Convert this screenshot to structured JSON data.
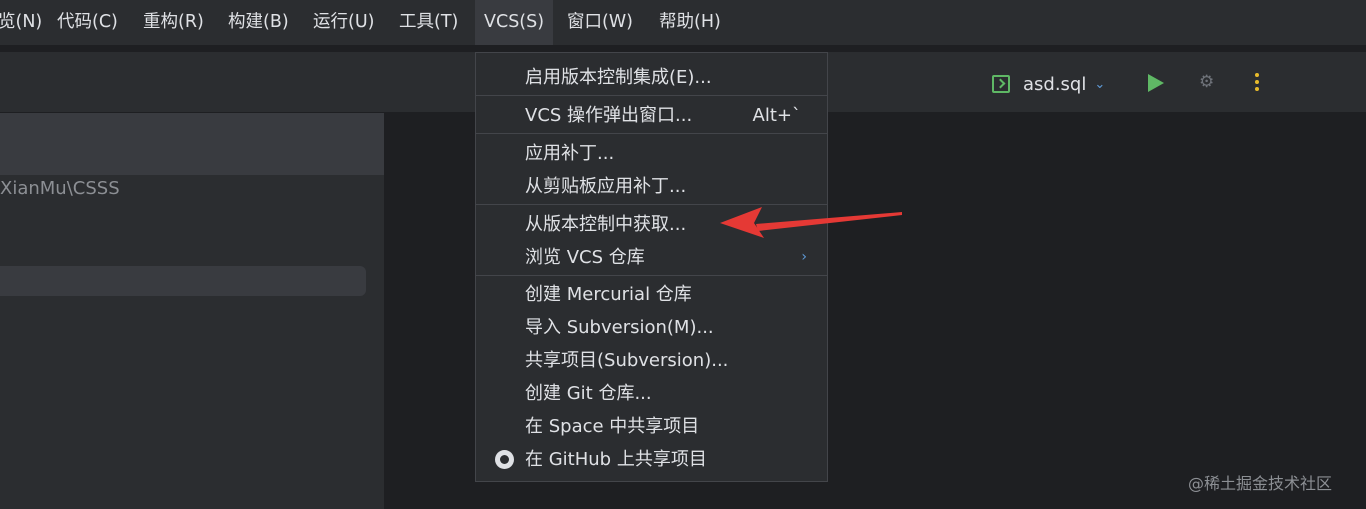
{
  "menubar": {
    "items": [
      {
        "label": "览(N)"
      },
      {
        "label": "代码(C)"
      },
      {
        "label": "重构(R)"
      },
      {
        "label": "构建(B)"
      },
      {
        "label": "运行(U)"
      },
      {
        "label": "工具(T)"
      },
      {
        "label": "VCS(S)"
      },
      {
        "label": "窗口(W)"
      },
      {
        "label": "帮助(H)"
      }
    ]
  },
  "toolbar": {
    "run_config": "asd.sql",
    "icons": [
      "sql-file-icon",
      "chevron-down-icon",
      "run-icon",
      "debug-icon",
      "more-vertical-icon"
    ]
  },
  "project": {
    "path": "XianMu\\CSSS"
  },
  "vcs_menu": {
    "items": [
      {
        "label": "启用版本控制集成(E)..."
      },
      {
        "label": "VCS 操作弹出窗口...",
        "shortcut": "Alt+`"
      },
      {
        "label": "应用补丁..."
      },
      {
        "label": "从剪贴板应用补丁..."
      },
      {
        "label": "从版本控制中获取..."
      },
      {
        "label": "浏览 VCS 仓库"
      },
      {
        "label": "创建 Mercurial 仓库"
      },
      {
        "label": "导入 Subversion(M)..."
      },
      {
        "label": "共享项目(Subversion)..."
      },
      {
        "label": "创建 Git 仓库..."
      },
      {
        "label": "在 Space 中共享项目"
      },
      {
        "label": "在 GitHub 上共享项目"
      }
    ]
  },
  "colors": {
    "accent_green": "#5fb865",
    "annotation_red": "#e53935",
    "more_yellow": "#e8bb2b"
  },
  "watermark": "@稀土掘金技术社区"
}
